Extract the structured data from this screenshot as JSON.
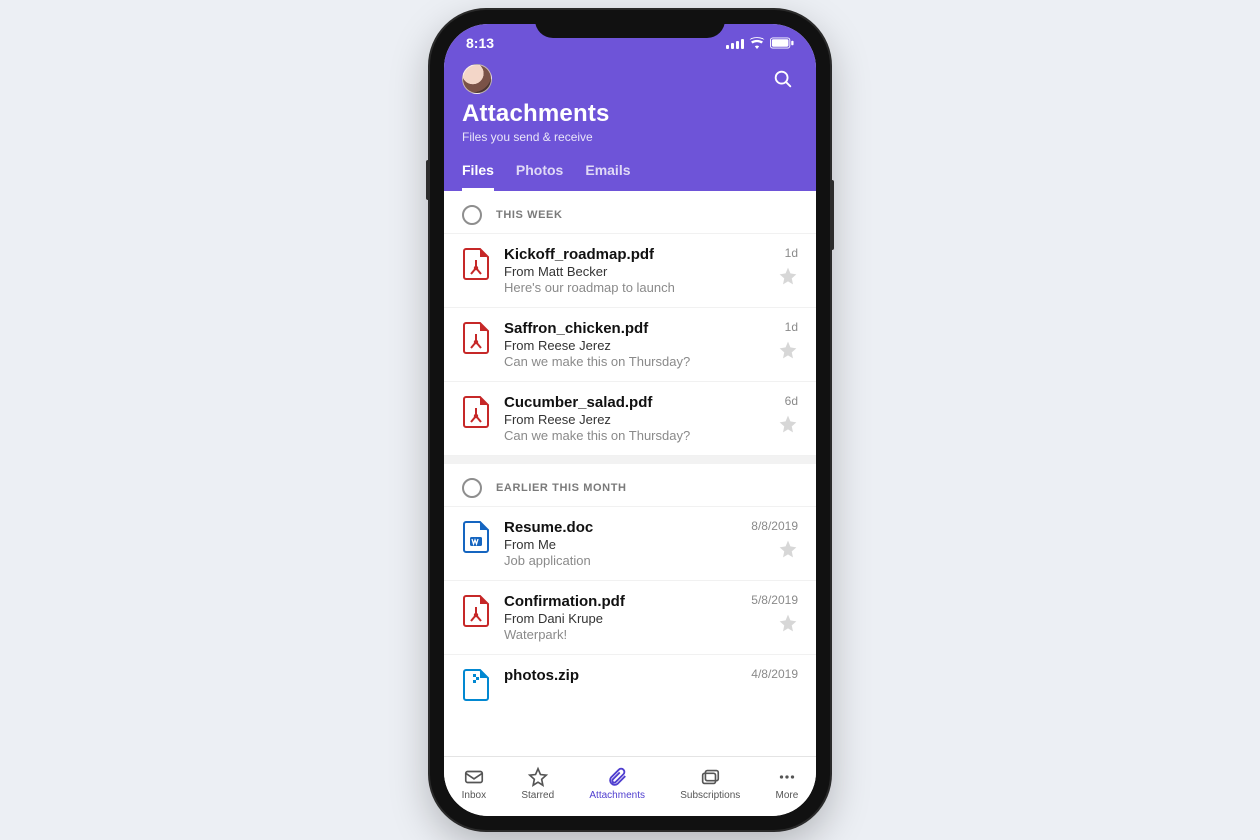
{
  "status": {
    "time": "8:13"
  },
  "header": {
    "title": "Attachments",
    "subtitle": "Files you send & receive",
    "tabs": [
      {
        "label": "Files",
        "active": true
      },
      {
        "label": "Photos",
        "active": false
      },
      {
        "label": "Emails",
        "active": false
      }
    ]
  },
  "sections": [
    {
      "label": "THIS WEEK",
      "items": [
        {
          "icon": "pdf",
          "name": "Kickoff_roadmap.pdf",
          "from": "From Matt Becker",
          "snippet": "Here's our roadmap to launch",
          "time": "1d"
        },
        {
          "icon": "pdf",
          "name": "Saffron_chicken.pdf",
          "from": "From Reese Jerez",
          "snippet": "Can we make this on Thursday?",
          "time": "1d"
        },
        {
          "icon": "pdf",
          "name": "Cucumber_salad.pdf",
          "from": "From Reese Jerez",
          "snippet": "Can we make this on Thursday?",
          "time": "6d"
        }
      ]
    },
    {
      "label": "EARLIER THIS MONTH",
      "items": [
        {
          "icon": "doc",
          "name": "Resume.doc",
          "from": "From Me",
          "snippet": "Job application",
          "time": "8/8/2019"
        },
        {
          "icon": "pdf",
          "name": "Confirmation.pdf",
          "from": "From Dani Krupe",
          "snippet": "Waterpark!",
          "time": "5/8/2019"
        },
        {
          "icon": "zip",
          "name": "photos.zip",
          "from": "",
          "snippet": "",
          "time": "4/8/2019"
        }
      ]
    }
  ],
  "nav": [
    {
      "key": "inbox",
      "label": "Inbox",
      "active": false
    },
    {
      "key": "starred",
      "label": "Starred",
      "active": false
    },
    {
      "key": "attachments",
      "label": "Attachments",
      "active": true
    },
    {
      "key": "subscriptions",
      "label": "Subscriptions",
      "active": false
    },
    {
      "key": "more",
      "label": "More",
      "active": false
    }
  ]
}
